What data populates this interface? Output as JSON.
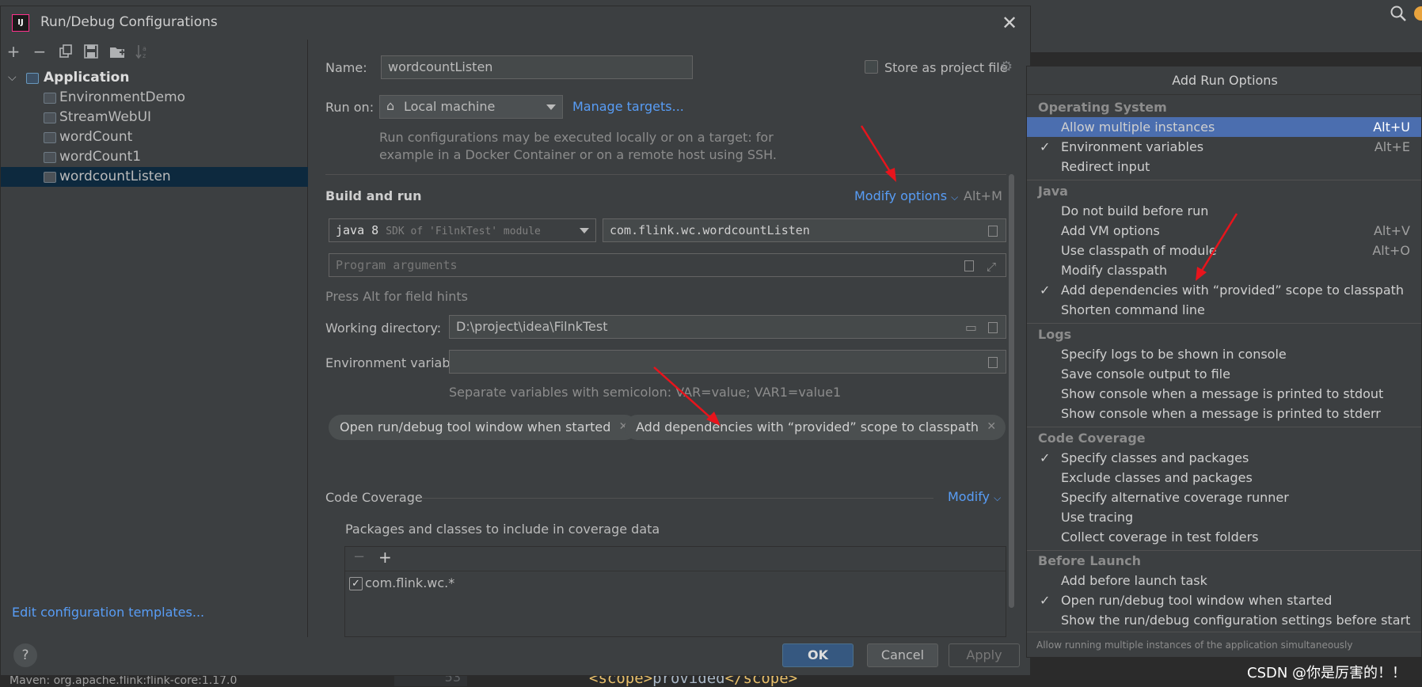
{
  "ide": {
    "maven_text": "Maven: org.apache.flink:flink-core:1.17.0",
    "line_number": "53",
    "code_open": "<scope>",
    "code_value": "provided",
    "code_close": "</scope>",
    "watermark": "CSDN @你是厉害的！！"
  },
  "dialog": {
    "title": "Run/Debug Configurations",
    "app_icon_text": "IJ",
    "toolbar_icons": [
      "add-icon",
      "remove-icon",
      "copy-icon",
      "save-icon",
      "new-folder-icon",
      "sort-icon"
    ],
    "tree": {
      "group": "Application",
      "items": [
        "EnvironmentDemo",
        "StreamWebUI",
        "wordCount",
        "wordCount1",
        "wordcountListen"
      ],
      "selected": "wordcountListen"
    },
    "edit_templates_link": "Edit configuration templates...",
    "name_label": "Name:",
    "name_value": "wordcountListen",
    "store_label": "Store as project file",
    "run_on_label": "Run on:",
    "run_on_value": "Local machine",
    "manage_targets": "Manage targets...",
    "run_on_hint_1": "Run configurations may be executed locally or on a target: for",
    "run_on_hint_2": "example in a Docker Container or on a remote host using SSH.",
    "build_and_run": "Build and run",
    "modify_options": "Modify options",
    "modify_shortcut": "Alt+M",
    "sdk_main": "java 8",
    "sdk_detail": "SDK of 'FilnkTest' module",
    "main_class": "com.flink.wc.wordcountListen",
    "program_args_placeholder": "Program arguments",
    "field_hints": "Press Alt for field hints",
    "working_dir_label": "Working directory:",
    "working_dir_value": "D:\\project\\idea\\FilnkTest",
    "env_vars_label": "Environment variables:",
    "env_vars_value": "",
    "env_hint": "Separate variables with semicolon: VAR=value; VAR1=value1",
    "chips": [
      "Open run/debug tool window when started",
      "Add dependencies with “provided” scope to classpath"
    ],
    "code_coverage": "Code Coverage",
    "modify": "Modify",
    "packages_label": "Packages and classes to include in coverage data",
    "coverage_item": "com.flink.wc.*",
    "buttons": {
      "help": "?",
      "ok": "OK",
      "cancel": "Cancel",
      "apply": "Apply"
    }
  },
  "popup": {
    "title": "Add Run Options",
    "groups": {
      "os": "Operating System",
      "java": "Java",
      "logs": "Logs",
      "coverage": "Code Coverage",
      "before": "Before Launch"
    },
    "os_items": [
      {
        "label": "Allow multiple instances",
        "shortcut": "Alt+U",
        "checked": false,
        "selected": true
      },
      {
        "label": "Environment variables",
        "shortcut": "Alt+E",
        "checked": true
      },
      {
        "label": "Redirect input",
        "shortcut": "",
        "checked": false
      }
    ],
    "java_items": [
      {
        "label": "Do not build before run",
        "shortcut": ""
      },
      {
        "label": "Add VM options",
        "shortcut": "Alt+V"
      },
      {
        "label": "Use classpath of module",
        "shortcut": "Alt+O"
      },
      {
        "label": "Modify classpath",
        "shortcut": ""
      },
      {
        "label": "Add dependencies with “provided” scope to classpath",
        "shortcut": "",
        "checked": true
      },
      {
        "label": "Shorten command line",
        "shortcut": ""
      }
    ],
    "logs_items": [
      "Specify logs to be shown in console",
      "Save console output to file",
      "Show console when a message is printed to stdout",
      "Show console when a message is printed to stderr"
    ],
    "coverage_items": [
      {
        "label": "Specify classes and packages",
        "checked": true
      },
      {
        "label": "Exclude classes and packages"
      },
      {
        "label": "Specify alternative coverage runner"
      },
      {
        "label": "Use tracing"
      },
      {
        "label": "Collect coverage in test folders"
      }
    ],
    "before_items": [
      {
        "label": "Add before launch task"
      },
      {
        "label": "Open run/debug tool window when started",
        "checked": true
      },
      {
        "label": "Show the run/debug configuration settings before start"
      }
    ],
    "footer": "Allow running multiple instances of the application simultaneously",
    "check_mark": "✓"
  }
}
